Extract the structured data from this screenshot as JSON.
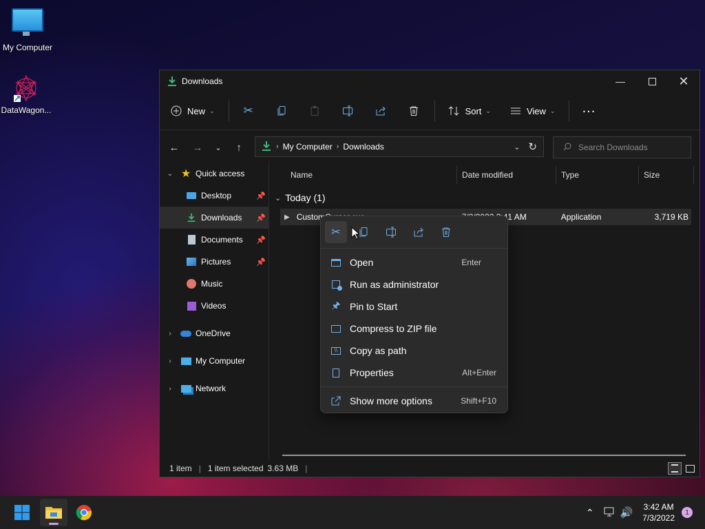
{
  "desktop": {
    "icons": [
      {
        "label": "My Computer"
      },
      {
        "label": "DataWagon..."
      }
    ]
  },
  "window": {
    "title": "Downloads",
    "toolbar": {
      "new_label": "New",
      "sort_label": "Sort",
      "view_label": "View"
    },
    "address": {
      "crumbs": [
        "My Computer",
        "Downloads"
      ],
      "search_placeholder": "Search Downloads"
    },
    "nav": {
      "quick_access": "Quick access",
      "items": [
        {
          "label": "Desktop",
          "pinned": true
        },
        {
          "label": "Downloads",
          "pinned": true,
          "selected": true
        },
        {
          "label": "Documents",
          "pinned": true
        },
        {
          "label": "Pictures",
          "pinned": true
        },
        {
          "label": "Music",
          "pinned": false
        },
        {
          "label": "Videos",
          "pinned": false
        }
      ],
      "roots": [
        "OneDrive",
        "My Computer",
        "Network"
      ]
    },
    "list": {
      "columns": [
        "Name",
        "Date modified",
        "Type",
        "Size"
      ],
      "group": "Today (1)",
      "rows": [
        {
          "name": "CustomCursor.exe",
          "date": "7/3/2022 3:41 AM",
          "type": "Application",
          "size": "3,719 KB"
        }
      ]
    },
    "status": {
      "count": "1 item",
      "selected": "1 item selected",
      "size": "3.63 MB"
    }
  },
  "context_menu": {
    "items": [
      {
        "label": "Open",
        "shortcut": "Enter"
      },
      {
        "label": "Run as administrator",
        "shortcut": ""
      },
      {
        "label": "Pin to Start",
        "shortcut": ""
      },
      {
        "label": "Compress to ZIP file",
        "shortcut": ""
      },
      {
        "label": "Copy as path",
        "shortcut": ""
      },
      {
        "label": "Properties",
        "shortcut": "Alt+Enter"
      }
    ],
    "more": {
      "label": "Show more options",
      "shortcut": "Shift+F10"
    }
  },
  "taskbar": {
    "time": "3:42 AM",
    "date": "7/3/2022",
    "notification_count": "1"
  },
  "colors": {
    "accent": "#6fb1e8",
    "window_bg": "#191919",
    "menu_bg": "#2b2b2b"
  }
}
